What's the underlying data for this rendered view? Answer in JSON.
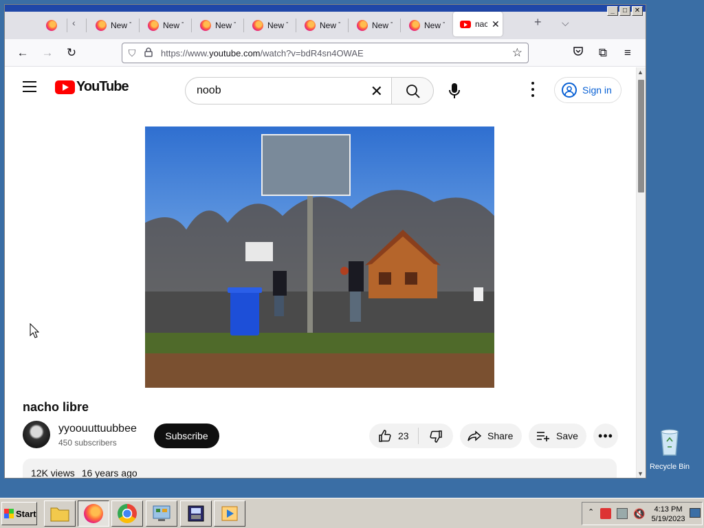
{
  "browser": {
    "tabs": [
      {
        "label": "New Tab"
      },
      {
        "label": "New Tab"
      },
      {
        "label": "New Tab"
      },
      {
        "label": "New Tab"
      },
      {
        "label": "New Tab"
      },
      {
        "label": "New Tab"
      },
      {
        "label": "New Tab"
      }
    ],
    "active_tab": {
      "label": "nacho libre - YouTube"
    },
    "url_prefix": "https://www.",
    "url_domain": "youtube.com",
    "url_rest": "/watch?v=bdR4sn4OWAE"
  },
  "youtube": {
    "logo_text": "YouTube",
    "search_value": "noob",
    "sign_in": "Sign in",
    "video_title": "nacho libre",
    "channel_name": "yyoouuttuubbee",
    "subscribers": "450 subscribers",
    "subscribe": "Subscribe",
    "likes": "23",
    "share": "Share",
    "save": "Save",
    "views": "12K views",
    "age": "16 years ago"
  },
  "desktop": {
    "recycle_bin": "Recycle Bin"
  },
  "taskbar": {
    "start": "Start",
    "time": "4:13 PM",
    "date": "5/19/2023"
  },
  "colors": {
    "yt_red": "#ff0000",
    "link_blue": "#065fd4",
    "desktop": "#3a6ea5",
    "titlebar": "#1f47a8"
  }
}
